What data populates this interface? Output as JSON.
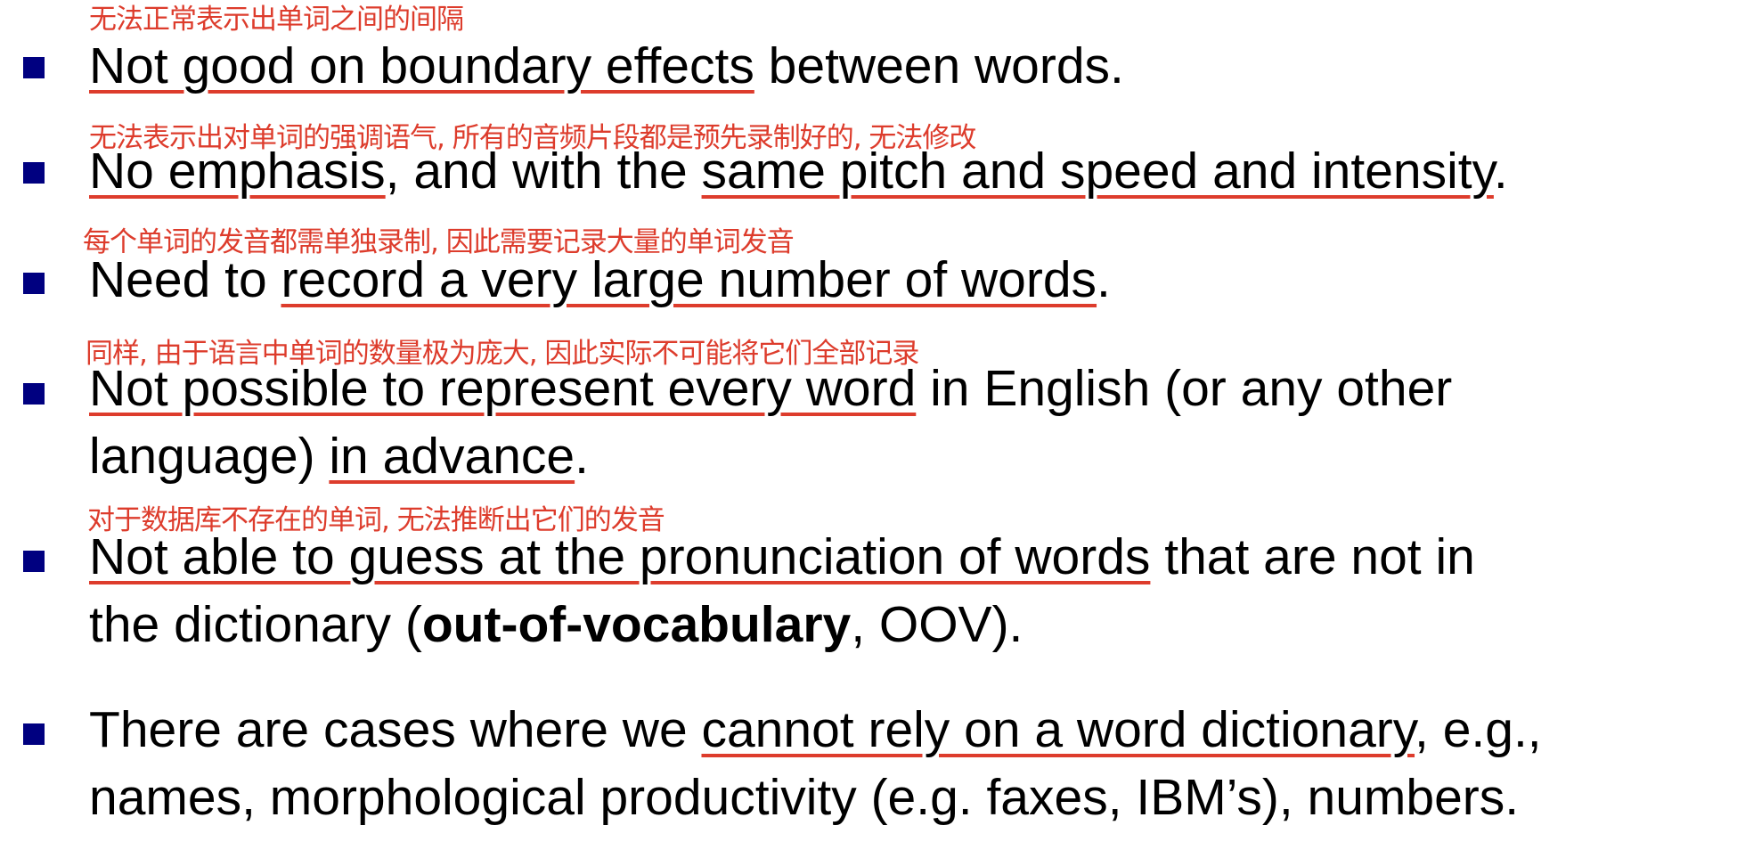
{
  "colors": {
    "bullet": "#000080",
    "annotation": "#dd3c2c",
    "text": "#000000"
  },
  "bullets": [
    {
      "note": "无法正常表示出单词之间的间隔",
      "lines": [
        [
          {
            "text": "Not good on boundary effects",
            "underline": true
          },
          {
            "text": " between words."
          }
        ]
      ]
    },
    {
      "note": "无法表示出对单词的强调语气, 所有的音频片段都是预先录制好的, 无法修改",
      "lines": [
        [
          {
            "text": "No emphasis",
            "underline": true
          },
          {
            "text": ", and with the "
          },
          {
            "text": "same pitch and speed and intensity",
            "underline": true
          },
          {
            "text": "."
          }
        ]
      ]
    },
    {
      "note": "每个单词的发音都需单独录制, 因此需要记录大量的单词发音",
      "lines": [
        [
          {
            "text": "Need to "
          },
          {
            "text": "record a very large number of words",
            "underline": true
          },
          {
            "text": "."
          }
        ]
      ]
    },
    {
      "note": "同样, 由于语言中单词的数量极为庞大, 因此实际不可能将它们全部记录",
      "lines": [
        [
          {
            "text": "Not possible to represent every word",
            "underline": true
          },
          {
            "text": " in English (or any other"
          }
        ],
        [
          {
            "text": "language) "
          },
          {
            "text": "in advance",
            "underline": true
          },
          {
            "text": "."
          }
        ]
      ]
    },
    {
      "note": "对于数据库不存在的单词, 无法推断出它们的发音",
      "lines": [
        [
          {
            "text": "Not able to guess at the pronunciation of words",
            "underline": true
          },
          {
            "text": " that are not in"
          }
        ],
        [
          {
            "text": "the dictionary ("
          },
          {
            "text": "out-of-vocabulary",
            "bold": true
          },
          {
            "text": ", OOV)."
          }
        ]
      ]
    },
    {
      "note": "",
      "lines": [
        [
          {
            "text": "There are cases where we "
          },
          {
            "text": "cannot rely on a word dictionary",
            "underline": true
          },
          {
            "text": ", e.g.,"
          }
        ],
        [
          {
            "text": "names, morphological productivity (e.g. faxes, IBM’s),  numbers."
          }
        ]
      ]
    }
  ]
}
